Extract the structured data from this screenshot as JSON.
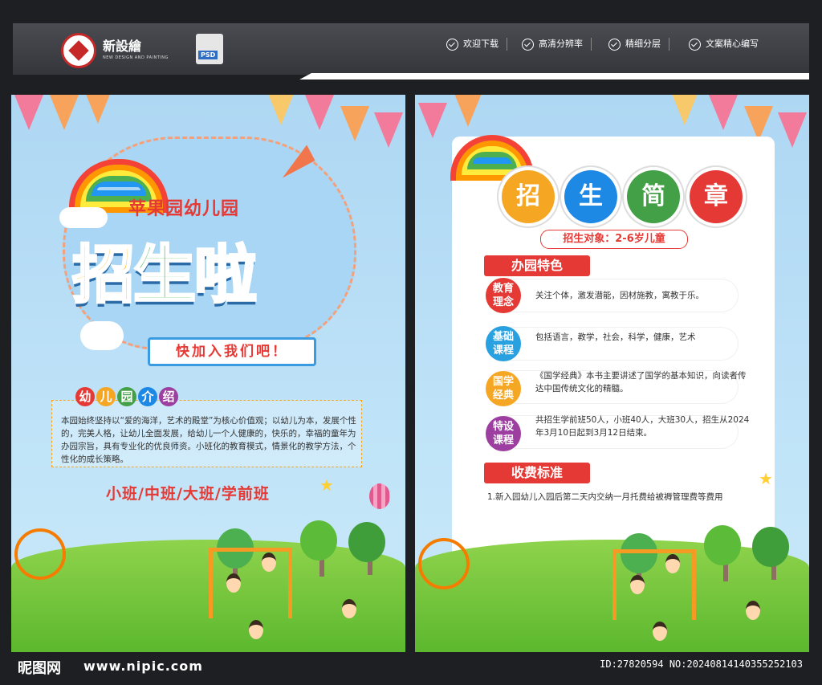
{
  "header": {
    "brand_name": "新設繪",
    "brand_sub": "NEW DESIGN AND PAINTING",
    "file_badge": "PSD",
    "features": [
      "欢迎下载",
      "高清分辨率",
      "精细分层",
      "文案精心编写"
    ]
  },
  "left": {
    "school_name": "苹果园幼儿园",
    "headline": [
      "招",
      "生",
      "啦"
    ],
    "slogan": "快加入我们吧！",
    "intro_title": [
      "幼",
      "儿",
      "园",
      "介",
      "绍"
    ],
    "intro_text": "本园始终坚持以“爱的海洋，艺术的殿堂”为核心价值观；以幼儿为本，发展个性的，完美人格，让幼儿全面发展，给幼儿一个人健康的，快乐的，幸福的童年为办园宗旨，具有专业化的优良师资。小班化的教育模式，情景化的教学方法，个性化的成长策略。",
    "classes": "小班/中班/大班/学前班"
  },
  "right": {
    "title_chars": [
      "招",
      "生",
      "简",
      "章"
    ],
    "title_colors": [
      "#f5a623",
      "#1e88e5",
      "#43a047",
      "#e53935"
    ],
    "target": "招生对象：2-6岁儿童",
    "features_title": "办园特色",
    "items": [
      {
        "label": "教育理念",
        "text": "关注个体，激发潜能，因材施教，寓教于乐。",
        "color": "#e53935"
      },
      {
        "label": "基础课程",
        "text": "包括语言，教学，社会，科学，健康，艺术",
        "color": "#29a0e0"
      },
      {
        "label": "国学经典",
        "text": "《国学经典》本书主要讲述了国学的基本知识，向读者传达中国传统文化的精髓。",
        "color": "#f5a623"
      },
      {
        "label": "特设课程",
        "text": "共招生学前班50人，小班40人，大班30人，招生从2024年3月10日起到3月12日结束。",
        "color": "#9c3fa0"
      }
    ],
    "fees_title": "收费标准",
    "fees_text": "1.新入园幼儿入园后第二天内交纳一月托费给被褥管理费等费用"
  },
  "footer": {
    "site_name": "昵图网",
    "site_url": "www.nipic.com",
    "ids": "ID:27820594 NO:20240814140355252103"
  }
}
